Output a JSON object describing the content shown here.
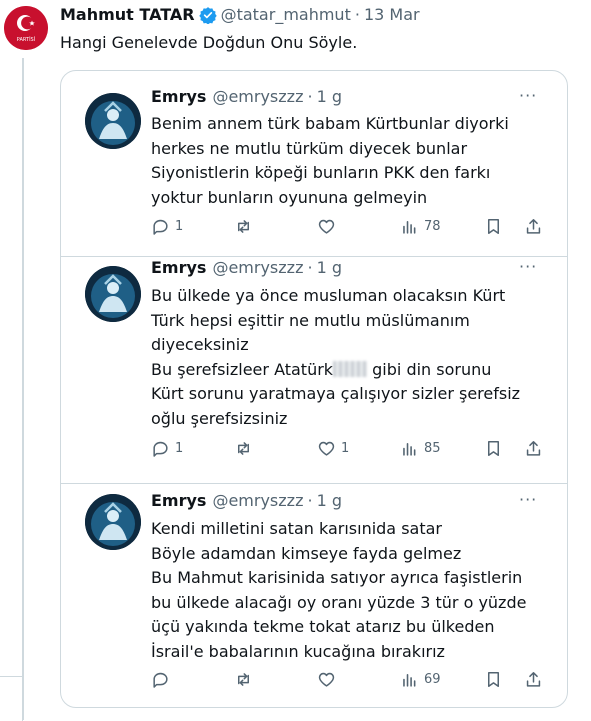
{
  "main_tweet": {
    "author_name": "Mahmut TATAR",
    "handle": "@tatar_mahmut",
    "date": "13 Mar",
    "text": "Hangi Genelevde Doğdun Onu Söyle.",
    "avatar_caption": "PARTİSİ"
  },
  "colors": {
    "verified": "#1d9bf0",
    "muted": "#536471",
    "border": "#cfd9de",
    "avatar_red": "#c8102e"
  },
  "replies": [
    {
      "name": "Emrys",
      "handle": "@emryszzz",
      "time": "1 g",
      "more": "···",
      "lines": [
        "Benim annem türk babam Kürtbunlar diyorki",
        "herkes ne mutlu türküm diyecek bunlar",
        "Siyonistlerin köpeği bunların PKK den farkı",
        "yoktur bunların oyununa gelmeyin"
      ],
      "stats": {
        "replies": "1",
        "retweets": "",
        "likes": "",
        "views": "78"
      }
    },
    {
      "name": "Emrys",
      "handle": "@emryszzz",
      "time": "1 g",
      "more": "···",
      "lines": [
        "Bu ülkede ya önce musluman olacaksın Kürt",
        "Türk hepsi eşittir ne mutlu müslümanım",
        "diyeceksiniz",
        "Bu şerefsizleer Atatürk",
        "Kürt sorunu yaratmaya çalışıyor sizler şerefsiz",
        "oğlu şerefsizsiniz"
      ],
      "line4_rest": " gibi din sorunu",
      "stats": {
        "replies": "1",
        "retweets": "",
        "likes": "1",
        "views": "85"
      }
    },
    {
      "name": "Emrys",
      "handle": "@emryszzz",
      "time": "1 g",
      "more": "···",
      "lines": [
        "Kendi milletini satan karısınida satar",
        "Böyle adamdan kimseye fayda gelmez",
        "Bu Mahmut karisinida satıyor ayrıca faşistlerin",
        "bu ülkede alacağı oy oranı yüzde 3 tür o yüzde",
        "üçü yakında tekme tokat atarız bu ülkeden",
        "İsrail'e babalarının kucağına bırakırız"
      ],
      "stats": {
        "replies": "",
        "retweets": "",
        "likes": "",
        "views": "69"
      }
    }
  ]
}
